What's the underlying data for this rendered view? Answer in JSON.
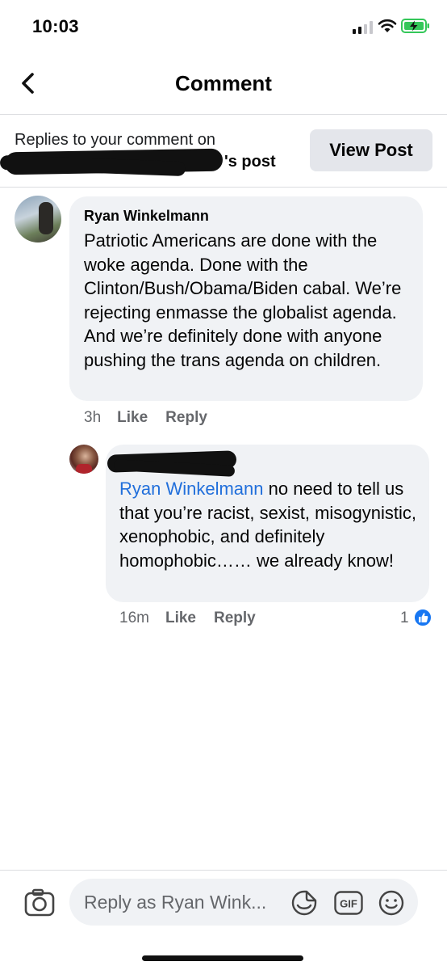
{
  "status_bar": {
    "time": "10:03",
    "icons": [
      "cellular-signal-icon",
      "wifi-icon",
      "battery-charging-icon"
    ]
  },
  "header": {
    "title": "Comment",
    "back_icon": "chevron-left-icon"
  },
  "context": {
    "line1": "Replies to your comment on",
    "post_suffix": "'s post",
    "view_post_label": "View Post"
  },
  "comments": [
    {
      "author": "Ryan Winkelmann",
      "text": "Patriotic Americans are done with the woke agenda. Done with the Clinton/Bush/Obama/Biden cabal. We’re rejecting enmasse the globalist agenda. And we’re definitely done with anyone pushing the trans agenda on children.",
      "time": "3h",
      "like_label": "Like",
      "reply_label": "Reply"
    }
  ],
  "replies": [
    {
      "mention": "Ryan Winkelmann",
      "text": " no need to tell us that you’re racist, sexist, misogynistic, xenophobic, and definitely homophobic…… we already know!",
      "time": "16m",
      "like_label": "Like",
      "reply_label": "Reply",
      "reaction_count": "1",
      "reaction_icon": "like-thumb-icon"
    }
  ],
  "composer": {
    "placeholder": "Reply as Ryan Wink...",
    "icons": [
      "camera-icon",
      "sticker-icon",
      "gif-icon",
      "emoji-icon"
    ],
    "gif_label": "GIF"
  },
  "colors": {
    "accent": "#1877f2",
    "mention": "#216fdb",
    "bubble": "#f0f2f5",
    "secondary_text": "#65676b"
  }
}
